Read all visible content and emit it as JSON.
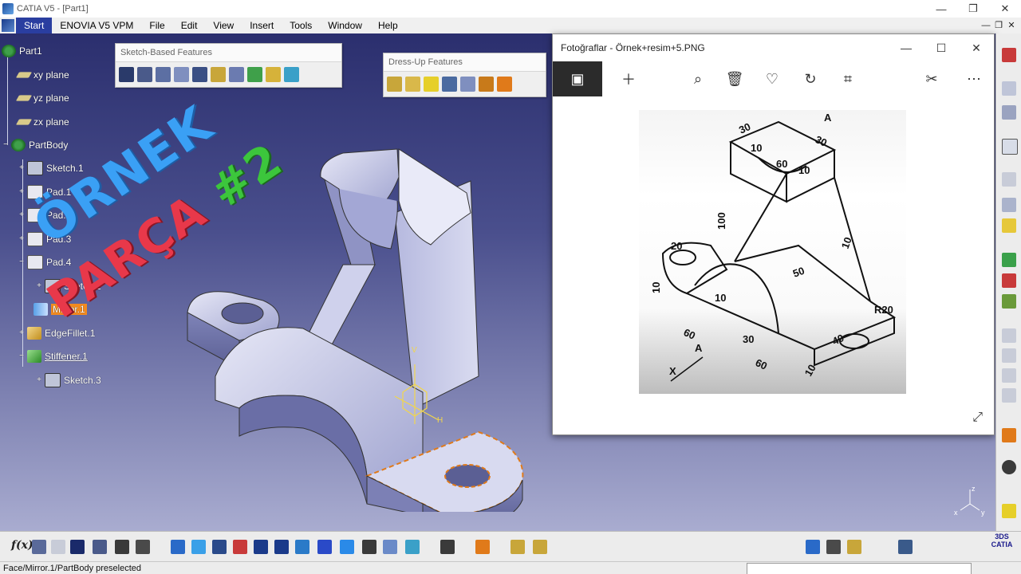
{
  "window": {
    "title": "CATIA V5 - [Part1]",
    "controls": [
      "—",
      "❐",
      "✕"
    ]
  },
  "menubar": {
    "items": [
      "Start",
      "ENOVIA V5 VPM",
      "File",
      "Edit",
      "View",
      "Insert",
      "Tools",
      "Window",
      "Help"
    ],
    "mini_controls": [
      "—",
      "❐",
      "✕"
    ]
  },
  "tree": {
    "items": [
      {
        "label": "Part1",
        "icon": "part-icon"
      },
      {
        "label": "xy plane",
        "icon": "plane-icon"
      },
      {
        "label": "yz plane",
        "icon": "plane-icon"
      },
      {
        "label": "zx plane",
        "icon": "plane-icon"
      },
      {
        "label": "PartBody",
        "icon": "gear-icon"
      },
      {
        "label": "Sketch.1",
        "icon": "sketch-icon"
      },
      {
        "label": "Pad.1",
        "icon": "pad-icon"
      },
      {
        "label": "Pad.2",
        "icon": "pad-icon"
      },
      {
        "label": "Pad.3",
        "icon": "pad-icon"
      },
      {
        "label": "Pad.4",
        "icon": "pad-icon"
      },
      {
        "label": "Sketch.2",
        "icon": "sketch-icon"
      },
      {
        "label": "Mirror.1",
        "icon": "mirror-icon"
      },
      {
        "label": "EdgeFillet.1",
        "icon": "fillet-icon"
      },
      {
        "label": "Stiffener.1",
        "icon": "stiffener-icon"
      },
      {
        "label": "Sketch.3",
        "icon": "sketch-icon"
      }
    ]
  },
  "toolbars": {
    "sketch_based": {
      "title": "Sketch-Based Features"
    },
    "dress_up": {
      "title": "Dress-Up Features"
    }
  },
  "overlay": {
    "line1": "ÖRNEK",
    "line2": "PARÇA",
    "line3": "#2"
  },
  "photos": {
    "title": "Fotoğraflar - Örnek+resim+5.PNG",
    "controls": [
      "—",
      "☐",
      "✕"
    ],
    "toolbar": [
      "image-icon",
      "add-icon",
      "zoom-icon",
      "delete-icon",
      "favorite-icon",
      "rotate-icon",
      "crop-icon",
      "edit-icon",
      "more-icon"
    ],
    "drawing_labels": {
      "d30a": "30",
      "dA1": "A",
      "d30b": "30",
      "d10a": "10",
      "d60": "60",
      "d10b": "10",
      "d100": "100",
      "d10c": "10",
      "d50": "50",
      "d20": "20",
      "d10d": "10",
      "d10e": "10",
      "dR20": "R20",
      "d60b": "60",
      "dA2": "A",
      "d30c": "30",
      "d40": "40",
      "d60c": "60",
      "d10f": "10",
      "dX": "X"
    }
  },
  "viewport": {
    "compass_labels": {
      "z": "z",
      "x": "x",
      "y": "y"
    }
  },
  "status": {
    "text": "Face/Mirror.1/PartBody preselected"
  },
  "colors": {
    "highlight": "#f28a1f",
    "selection_edge": "#e07a1a",
    "part_face": "#c9cbe6"
  }
}
